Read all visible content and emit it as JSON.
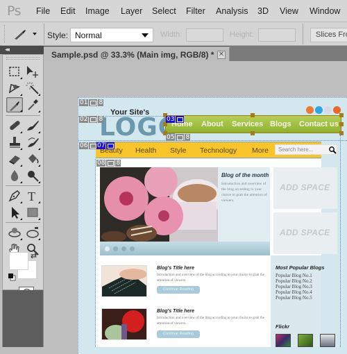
{
  "app": {
    "logo": "Ps"
  },
  "menu": [
    "File",
    "Edit",
    "Image",
    "Layer",
    "Select",
    "Filter",
    "Analysis",
    "3D",
    "View",
    "Window"
  ],
  "options_bar": {
    "style_label": "Style:",
    "style_value": "Normal",
    "width_label": "Width:",
    "width_value": "",
    "height_label": "Height:",
    "height_value": "",
    "slices_button": "Slices From Guides"
  },
  "tools": {
    "collapse": "◂◂",
    "items": [
      {
        "name": "rectangular-marquee-tool"
      },
      {
        "name": "move-tool"
      },
      {
        "name": "lasso-tool"
      },
      {
        "name": "magic-wand-tool"
      },
      {
        "name": "slice-select-tool",
        "active": true
      },
      {
        "name": "eyedropper-tool"
      },
      {
        "name": "healing-brush-tool"
      },
      {
        "name": "brush-tool"
      },
      {
        "name": "clone-stamp-tool"
      },
      {
        "name": "history-brush-tool"
      },
      {
        "name": "eraser-tool"
      },
      {
        "name": "paint-bucket-tool"
      },
      {
        "name": "blur-tool"
      },
      {
        "name": "dodge-tool"
      },
      {
        "name": "pen-tool"
      },
      {
        "name": "type-tool"
      },
      {
        "name": "path-selection-tool"
      },
      {
        "name": "rectangle-shape-tool"
      },
      {
        "name": "3d-rotate-tool"
      },
      {
        "name": "3d-orbit-tool"
      },
      {
        "name": "hand-tool"
      },
      {
        "name": "zoom-tool"
      }
    ],
    "foreground_color": "#ffffff",
    "background_color": "#ffffff",
    "swap_icon": "⇄"
  },
  "document": {
    "tab_title": "Sample.psd @ 33.3% (Main img, RGB/8) *",
    "close": "✕"
  },
  "slices": [
    {
      "id": "01",
      "badge": "8",
      "selected": false
    },
    {
      "id": "02",
      "badge": "8",
      "selected": false
    },
    {
      "id": "03",
      "badge": "",
      "selected": true
    },
    {
      "id": "05",
      "badge": "8",
      "selected": false
    },
    {
      "id": "06",
      "badge": "",
      "selected": false
    },
    {
      "id": "07",
      "badge": "",
      "selected": true
    },
    {
      "id": "08",
      "badge": "8",
      "selected": false
    }
  ],
  "site": {
    "logo_tag": "Your Site's",
    "logo": "LOGO",
    "social_colors": [
      "#ec7a33",
      "#2fa6e0",
      "#d9d9e6",
      "#e8692e"
    ],
    "top_nav": [
      "Home",
      "About",
      "Services",
      "Blogs",
      "Contact us"
    ],
    "categories": [
      "Beauty",
      "Health",
      "Style",
      "Technology",
      "More"
    ],
    "search_placeholder": "Search here...",
    "hero": {
      "title": "Blog of the month",
      "body": "Introduction and overview of the blog according to your choice to grab the attention of viewers."
    },
    "ads": [
      "ADD SPACE",
      "ADD SPACE"
    ],
    "blogs": [
      {
        "title": "Blog's Title here",
        "body": "Introduction and overview of the blog according to your choice to grab the attention of viewers.",
        "button": "Continue Reading"
      },
      {
        "title": "Blog's Title here",
        "body": "Introduction and overview of the blog according to your choice to grab the attention of viewers.",
        "button": "Continue Reading"
      }
    ],
    "popular_title": "Most Popular Blogs",
    "popular": [
      "Popular Blog No.1",
      "Popular Blog No.2",
      "Popular Blog No.3",
      "Popular Blog No.4",
      "Popular Blog No.5"
    ],
    "flickr_title": "Flickr"
  },
  "colors": {
    "nav_green": "#9dbd3d",
    "cat_yellow": "#f8c62a",
    "logo_blue": "#6c98ae",
    "slice_selected": "#1a12d8"
  }
}
